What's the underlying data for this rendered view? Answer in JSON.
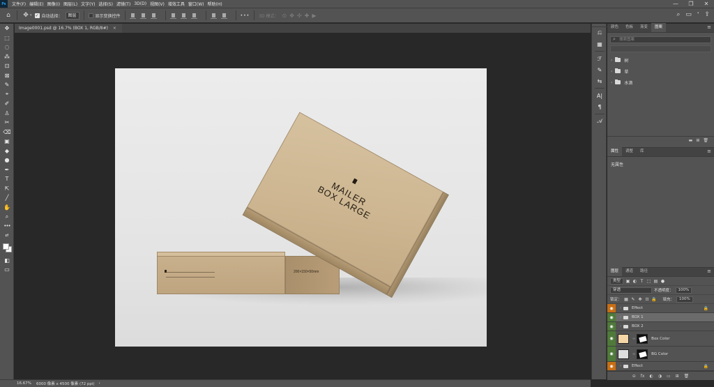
{
  "app": {
    "logo": "Ps",
    "menu": [
      "文件(F)",
      "编辑(E)",
      "图像(I)",
      "图层(L)",
      "文字(Y)",
      "选择(S)",
      "滤镜(T)",
      "3D(D)",
      "视图(V)",
      "增效工具",
      "窗口(W)",
      "帮助(H)"
    ],
    "window_controls": {
      "minimize": "—",
      "restore": "❐",
      "close": "✕"
    }
  },
  "options_bar": {
    "home": "⌂",
    "move": "✥",
    "auto_select_label": "自动选择：",
    "auto_select_value": "图层",
    "show_transform_label": "显示变换控件",
    "more": "•••",
    "mode3d_label": "3D 模式：",
    "search": "⌕",
    "workspace": "▭"
  },
  "toolbar": {
    "tools": [
      "✥",
      "⬚",
      "◌",
      "⁂",
      "⊡",
      "⊠",
      "✎",
      "⌖",
      "✐",
      "♙",
      "✂",
      "⌫",
      "▣",
      "◆",
      "●",
      "✒",
      "T",
      "⇱",
      "╱",
      "✋",
      "⌕"
    ]
  },
  "document": {
    "tab_title": "Image0001.psd @ 16.7% (BOX 1, RGB/8#)",
    "close": "×"
  },
  "artwork": {
    "small_box_dim": "200×150×50mm",
    "large_box_line1": "MAILER",
    "large_box_line2": "BOX LARGE"
  },
  "library_panel": {
    "tabs": [
      "颜色",
      "色板",
      "渐变",
      "图案"
    ],
    "search_placeholder": "搜索图案",
    "items": [
      {
        "label": "树"
      },
      {
        "label": "草"
      },
      {
        "label": "水滴"
      }
    ]
  },
  "properties_panel": {
    "tabs": [
      "属性",
      "调整",
      "库"
    ],
    "empty_text": "无属性"
  },
  "layers_panel": {
    "tabs": [
      "图层",
      "通道",
      "路径"
    ],
    "filter_kind": "类型",
    "blend_mode": "穿透",
    "opacity_label": "不透明度：",
    "opacity_value": "100%",
    "lock_label": "锁定：",
    "fill_label": "填充：",
    "fill_value": "100%",
    "layers": [
      {
        "name": "Effect",
        "type": "group",
        "eye": "orange",
        "locked": true
      },
      {
        "name": "BOX 1",
        "type": "group",
        "eye": "green",
        "selected": true
      },
      {
        "name": "BOX 2",
        "type": "group",
        "eye": "green"
      },
      {
        "name": "Box Color",
        "type": "fill",
        "eye": "green",
        "thumb": "peach"
      },
      {
        "name": "BG Color",
        "type": "fill",
        "eye": "green",
        "thumb": "grey"
      },
      {
        "name": "Effect",
        "type": "group",
        "eye": "orange",
        "locked": true
      }
    ],
    "footer_icons": [
      "⊝",
      "fx",
      "◐",
      "◑",
      "▭",
      "⊞",
      "🗑"
    ]
  },
  "status_bar": {
    "zoom": "16.67%",
    "doc_info": "6000 像素 x 4500 像素 (72 ppi)",
    "arrow": "›"
  }
}
